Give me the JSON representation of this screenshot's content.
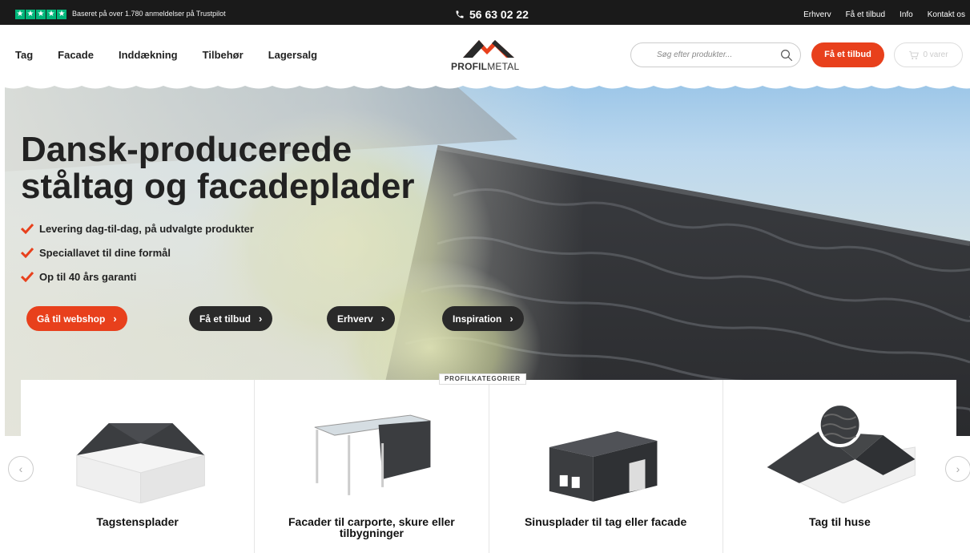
{
  "topbar": {
    "trustpilot_text": "Baseret på over 1.780 anmeldelser på Trustpilot",
    "phone": "56 63 02 22",
    "links": [
      "Erhverv",
      "Få et tilbud",
      "Info",
      "Kontakt os"
    ]
  },
  "nav": {
    "items": [
      "Tag",
      "Facade",
      "Inddækning",
      "Tilbehør",
      "Lagersalg"
    ]
  },
  "logo": {
    "strong": "PROFIL",
    "light": "METAL"
  },
  "search": {
    "placeholder": "Søg efter produkter..."
  },
  "header_cta": "Få et tilbud",
  "cart": {
    "label": "0 varer"
  },
  "hero": {
    "title_line1": "Dansk-producerede",
    "title_line2": "ståltag og facadeplader",
    "bullets": [
      "Levering dag-til-dag, på udvalgte produkter",
      "Speciallavet til dine formål",
      "Op til 40 års garanti"
    ],
    "buttons": [
      "Gå til webshop",
      "Få et tilbud",
      "Erhverv",
      "Inspiration"
    ]
  },
  "categories": {
    "tag": "PROFILKATEGORIER",
    "items": [
      "Tagstensplader",
      "Facader til carporte, skure eller tilbygninger",
      "Sinusplader til tag eller facade",
      "Tag til huse"
    ]
  },
  "colors": {
    "accent": "#e8401c",
    "dark": "#2a2a2a",
    "trustpilot": "#00b67a"
  }
}
